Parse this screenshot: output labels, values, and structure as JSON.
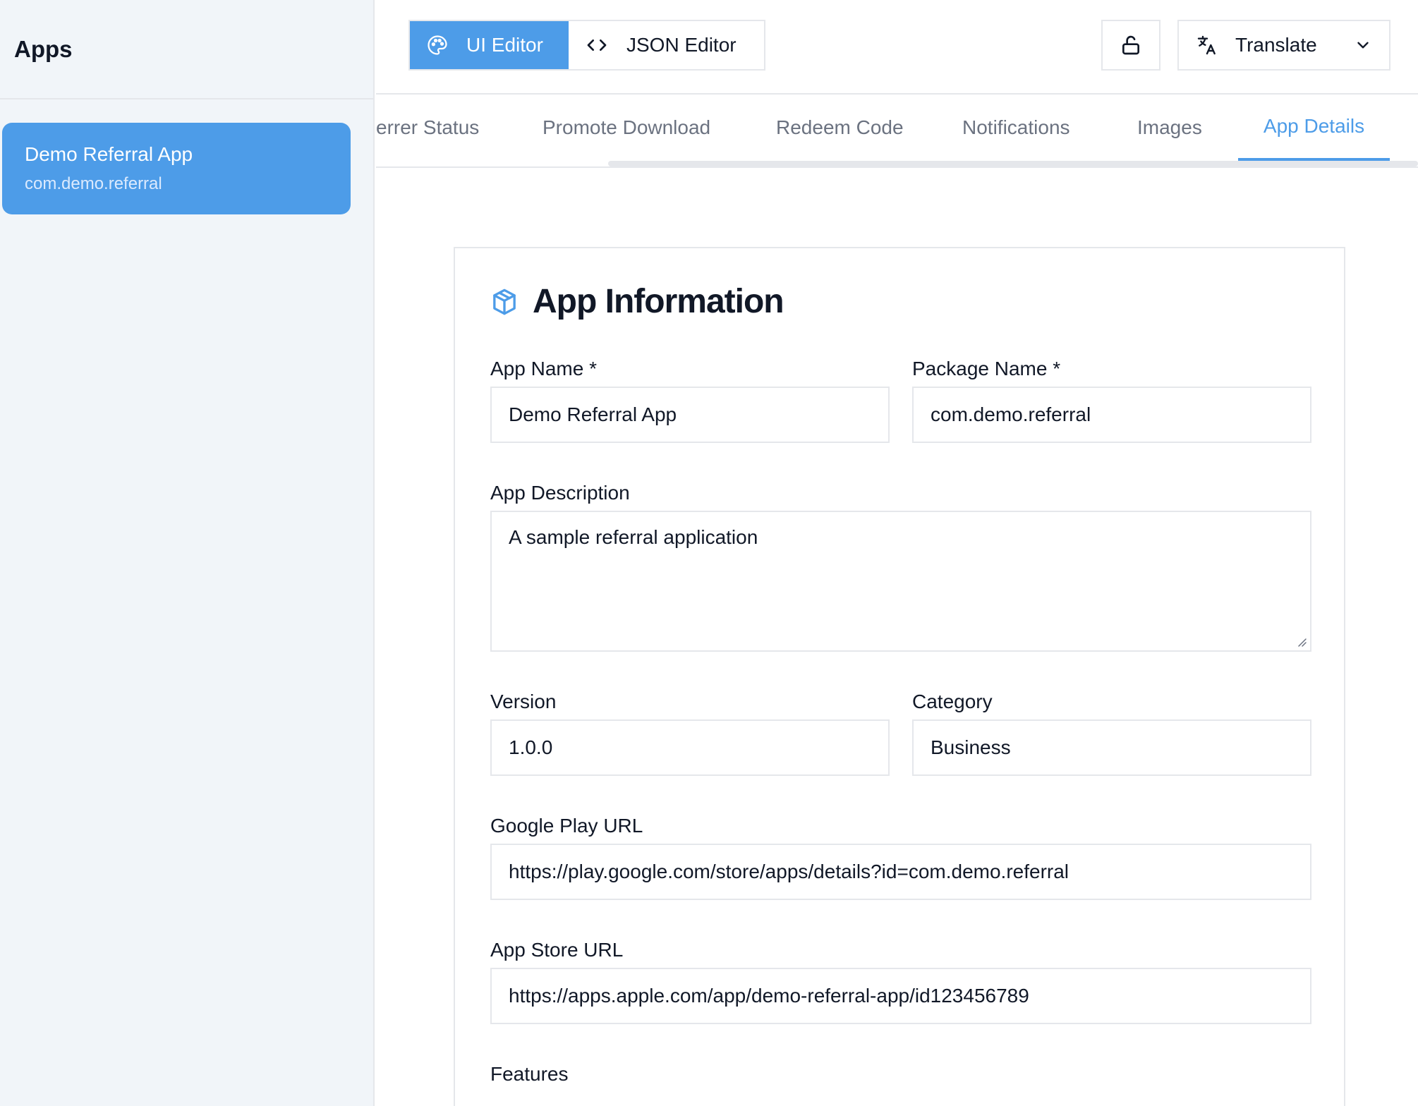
{
  "sidebar": {
    "title": "Apps",
    "apps": [
      {
        "name": "Demo Referral App",
        "package": "com.demo.referral"
      }
    ]
  },
  "toolbar": {
    "ui_editor_label": "UI Editor",
    "json_editor_label": "JSON Editor",
    "translate_label": "Translate",
    "accent_color": "#4d9ce8"
  },
  "tabs": [
    {
      "label": "errer Status",
      "active": false
    },
    {
      "label": "Promote Download",
      "active": false
    },
    {
      "label": "Redeem Code",
      "active": false
    },
    {
      "label": "Notifications",
      "active": false
    },
    {
      "label": "Images",
      "active": false
    },
    {
      "label": "App Details",
      "active": true
    }
  ],
  "form": {
    "title": "App Information",
    "app_name": {
      "label": "App Name *",
      "value": "Demo Referral App"
    },
    "package_name": {
      "label": "Package Name *",
      "value": "com.demo.referral"
    },
    "description": {
      "label": "App Description",
      "value": "A sample referral application"
    },
    "version": {
      "label": "Version",
      "value": "1.0.0"
    },
    "category": {
      "label": "Category",
      "value": "Business"
    },
    "google_play_url": {
      "label": "Google Play URL",
      "value": "https://play.google.com/store/apps/details?id=com.demo.referral"
    },
    "app_store_url": {
      "label": "App Store URL",
      "value": "https://apps.apple.com/app/demo-referral-app/id123456789"
    },
    "features_label": "Features"
  }
}
